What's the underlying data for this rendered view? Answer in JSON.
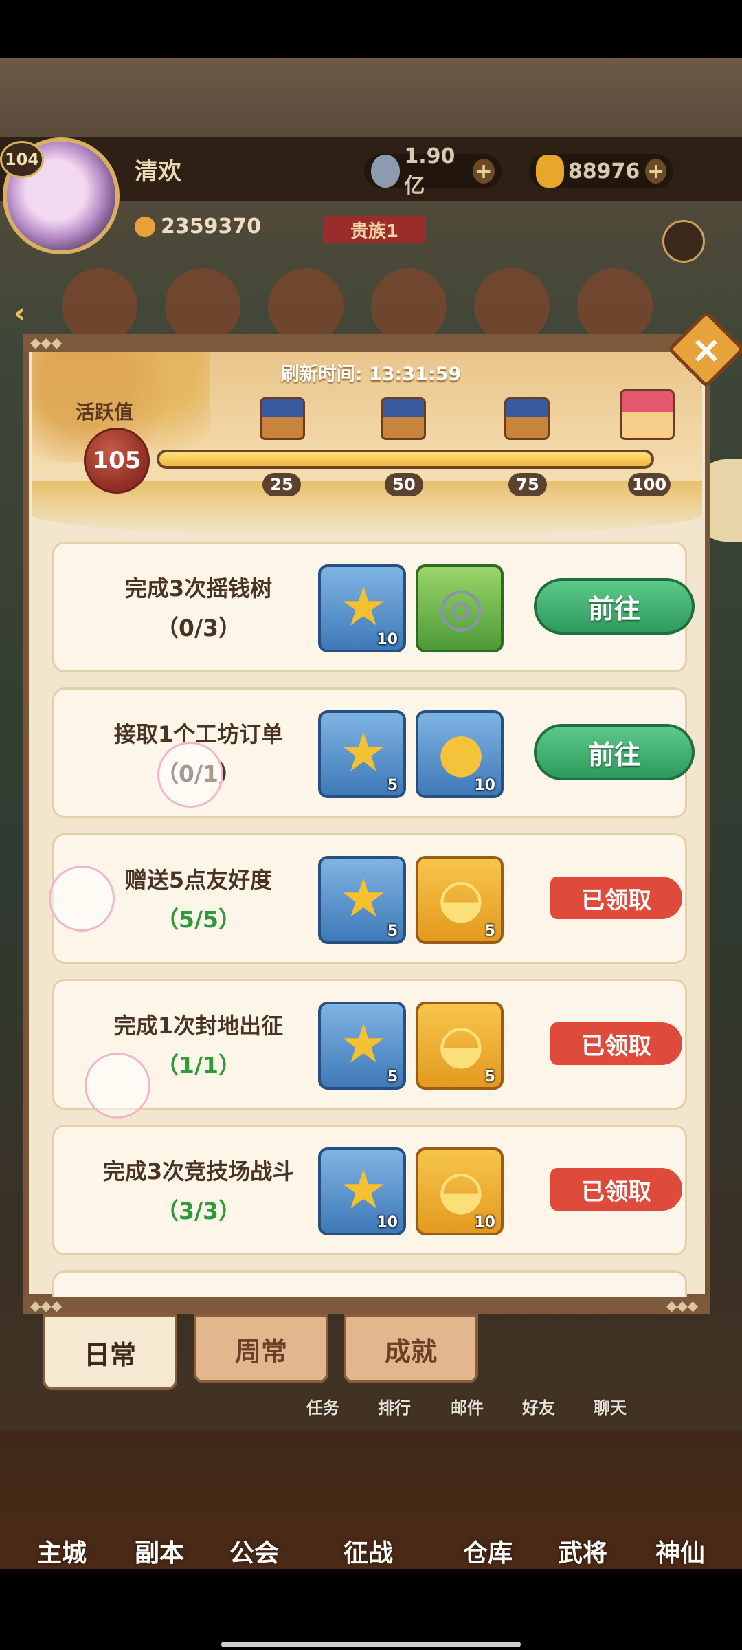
{
  "player": {
    "level": "104",
    "name": "清欢",
    "power": "2359370",
    "noble": "贵族1"
  },
  "currencies": {
    "coins": "1.90亿",
    "ingots": "88976"
  },
  "activity": {
    "refresh_label": "刷新时间: 13:31:59",
    "label": "活跃值",
    "value": "105",
    "progress": 1.0,
    "milestones": [
      "25",
      "50",
      "75",
      "100"
    ]
  },
  "tasks": [
    {
      "title": "完成3次摇钱树",
      "progress": "（0/3）",
      "status": "go",
      "button": "前往",
      "rewards": [
        {
          "icon": "star-icon",
          "count": "10"
        },
        {
          "icon": "copper-coins-icon",
          "count": ""
        }
      ]
    },
    {
      "title": "接取1个工坊订单",
      "progress": "（0/1）",
      "status": "go",
      "button": "前往",
      "rewards": [
        {
          "icon": "star-icon",
          "count": "5"
        },
        {
          "icon": "gold-coin-icon",
          "count": "10"
        }
      ]
    },
    {
      "title": "赠送5点友好度",
      "progress": "（5/5）",
      "status": "done",
      "button": "已领取",
      "rewards": [
        {
          "icon": "star-icon",
          "count": "5"
        },
        {
          "icon": "gold-ingot-icon",
          "count": "5"
        }
      ]
    },
    {
      "title": "完成1次封地出征",
      "progress": "（1/1）",
      "status": "done",
      "button": "已领取",
      "rewards": [
        {
          "icon": "star-icon",
          "count": "5"
        },
        {
          "icon": "gold-ingot-icon",
          "count": "5"
        }
      ]
    },
    {
      "title": "完成3次竞技场战斗",
      "progress": "（3/3）",
      "status": "done",
      "button": "已领取",
      "rewards": [
        {
          "icon": "star-icon",
          "count": "10"
        },
        {
          "icon": "gold-ingot-icon",
          "count": "10"
        }
      ]
    }
  ],
  "tabs": {
    "daily": "日常",
    "weekly": "周常",
    "achievement": "成就"
  },
  "sub_nav": {
    "task": "任务",
    "rank": "排行",
    "mail": "邮件",
    "friends": "好友",
    "chat": "聊天"
  },
  "bottom_nav": {
    "city": "主城",
    "dungeon": "副本",
    "guild": "公会",
    "battle": "征战",
    "warehouse": "仓库",
    "generals": "武将",
    "immortal": "神仙"
  },
  "colors": {
    "go_button": "#3fae6e",
    "claimed_badge": "#e04a3a",
    "panel": "#f3e6cf",
    "frame": "#7a5638"
  }
}
